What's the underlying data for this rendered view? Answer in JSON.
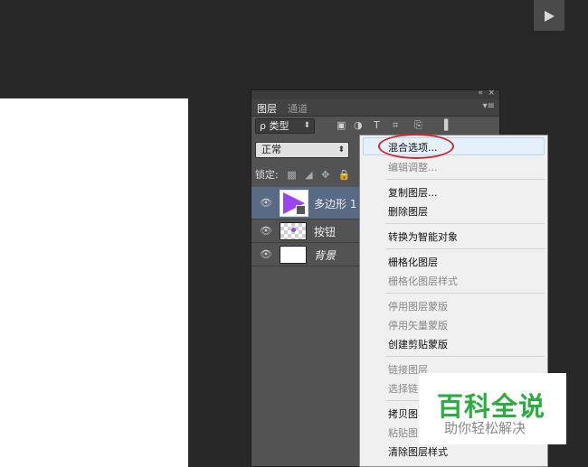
{
  "toolbar": {
    "play_icon": "play-triangle-icon"
  },
  "panel": {
    "collapse_icon": "«",
    "close_icon": "×",
    "tabs": [
      {
        "label": "图层"
      },
      {
        "label": "通道"
      }
    ],
    "menu_icon": "▾≡",
    "filter": {
      "kind_label": "ρ 类型",
      "arrow": "⬍",
      "icons": [
        "▣",
        "◑",
        "T",
        "⌗",
        "⎘",
        "▌"
      ]
    },
    "blend_mode": {
      "value": "正常",
      "arrow": "⬍"
    },
    "lock": {
      "label": "锁定:",
      "icons": [
        "▩",
        "◢",
        "✥",
        "🔒"
      ]
    },
    "layers": [
      {
        "name": "多边形 1",
        "selected": true,
        "eye": "👁"
      },
      {
        "name": "按钮",
        "selected": false,
        "eye": "👁"
      },
      {
        "name": "背景",
        "selected": false,
        "eye": "👁"
      }
    ]
  },
  "context_menu": {
    "items": [
      {
        "label": "混合选项...",
        "enabled": true,
        "highlighted": true
      },
      {
        "label": "编辑调整...",
        "enabled": false
      },
      {
        "label": "复制图层...",
        "enabled": true
      },
      {
        "label": "删除图层",
        "enabled": true
      },
      {
        "label": "转换为智能对象",
        "enabled": true
      },
      {
        "label": "栅格化图层",
        "enabled": true
      },
      {
        "label": "栅格化图层样式",
        "enabled": false
      },
      {
        "label": "停用图层蒙版",
        "enabled": false
      },
      {
        "label": "停用矢量蒙版",
        "enabled": false
      },
      {
        "label": "创建剪贴蒙版",
        "enabled": true
      },
      {
        "label": "链接图层",
        "enabled": false
      },
      {
        "label": "选择链",
        "enabled": false
      },
      {
        "label": "拷贝图",
        "enabled": true
      },
      {
        "label": "粘贴图",
        "enabled": false
      },
      {
        "label": "清除图层样式",
        "enabled": true
      }
    ]
  },
  "watermark": {
    "title": "百科全说",
    "subtitle": "助你轻松解决"
  },
  "colors": {
    "workspace": "#282828",
    "panel": "#535353",
    "selected_layer": "#596a84",
    "menu_bg": "#f0f0f0",
    "ring": "#d02a2a",
    "watermark_green": "#2aae3f",
    "shape_purple": "#9a43f0"
  }
}
